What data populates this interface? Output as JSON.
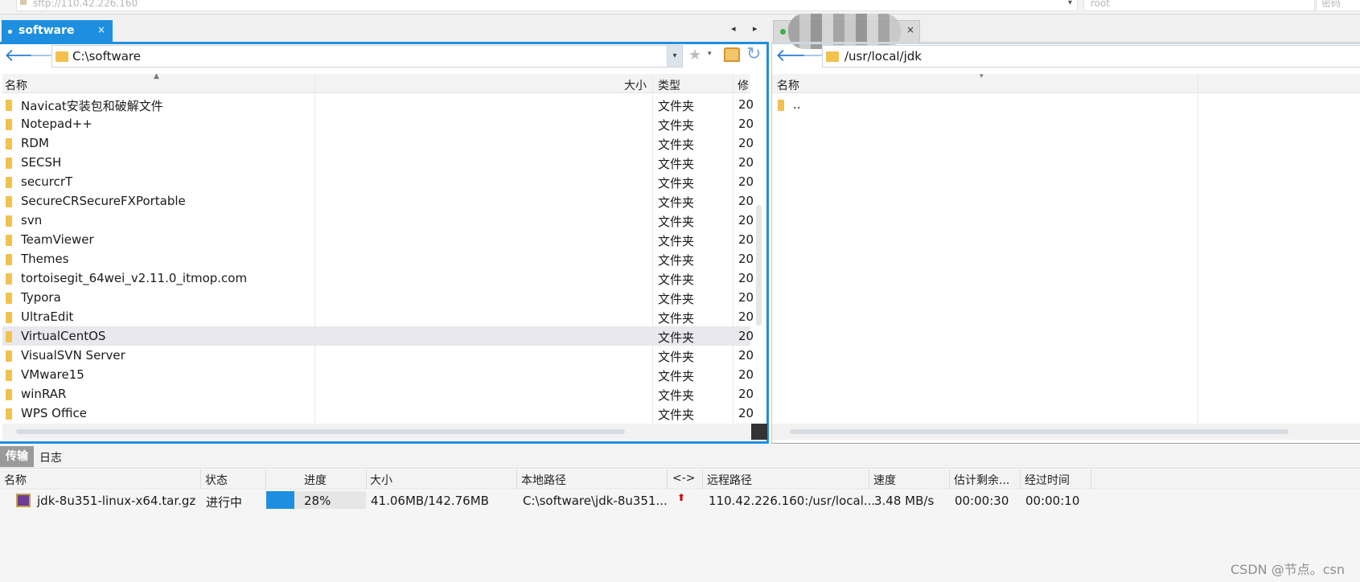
{
  "connection": {
    "url": "sftp://110.42.226.160",
    "username": "root",
    "password_placeholder": "密码"
  },
  "left_pane": {
    "tab_label": "software",
    "tab_close": "×",
    "path": "C:\\software",
    "columns": {
      "name": "名称",
      "size": "大小",
      "type": "类型",
      "modified": "修"
    },
    "files": [
      {
        "name": "Navicat安装包和破解文件",
        "type": "文件夹",
        "modified": "20"
      },
      {
        "name": "Notepad++",
        "type": "文件夹",
        "modified": "20"
      },
      {
        "name": "RDM",
        "type": "文件夹",
        "modified": "20"
      },
      {
        "name": "SECSH",
        "type": "文件夹",
        "modified": "20"
      },
      {
        "name": "securcrT",
        "type": "文件夹",
        "modified": "20"
      },
      {
        "name": "SecureCRSecureFXPortable",
        "type": "文件夹",
        "modified": "20"
      },
      {
        "name": "svn",
        "type": "文件夹",
        "modified": "20"
      },
      {
        "name": "TeamViewer",
        "type": "文件夹",
        "modified": "20"
      },
      {
        "name": "Themes",
        "type": "文件夹",
        "modified": "20"
      },
      {
        "name": "tortoisegit_64wei_v2.11.0_itmop.com",
        "type": "文件夹",
        "modified": "20"
      },
      {
        "name": "Typora",
        "type": "文件夹",
        "modified": "20"
      },
      {
        "name": "UltraEdit",
        "type": "文件夹",
        "modified": "20"
      },
      {
        "name": "VirtualCentOS",
        "type": "文件夹",
        "modified": "20",
        "selected": true
      },
      {
        "name": "VisualSVN Server",
        "type": "文件夹",
        "modified": "20"
      },
      {
        "name": "VMware15",
        "type": "文件夹",
        "modified": "20"
      },
      {
        "name": "winRAR",
        "type": "文件夹",
        "modified": "20"
      },
      {
        "name": "WPS Office",
        "type": "文件夹",
        "modified": "20"
      }
    ]
  },
  "right_pane": {
    "tab_close": "×",
    "path": "/usr/local/jdk",
    "columns": {
      "name": "名称"
    },
    "files": [
      {
        "name": ".."
      }
    ]
  },
  "transfer_panel": {
    "tabs": {
      "transfer": "传输",
      "log": "日志"
    },
    "columns": {
      "name": "名称",
      "status": "状态",
      "progress": "进度",
      "size": "大小",
      "local_path": "本地路径",
      "direction": "<->",
      "remote_path": "远程路径",
      "speed": "速度",
      "eta": "估计剩余...",
      "elapsed": "经过时间"
    },
    "items": [
      {
        "name": "jdk-8u351-linux-x64.tar.gz",
        "status": "进行中",
        "progress_percent": 28,
        "progress_label": "28%",
        "size": "41.06MB/142.76MB",
        "local_path": "C:\\software\\jdk-8u351...",
        "direction_icon": "upload-arrow-icon",
        "remote_path": "110.42.226.160:/usr/local...",
        "speed": "3.48 MB/s",
        "eta": "00:00:30",
        "elapsed": "00:00:10"
      }
    ]
  },
  "icons": {
    "nav_prev": "◂",
    "nav_next": "▸",
    "back": "🡐",
    "forward": "🡒",
    "star": "★",
    "dropdown": "▾",
    "sort": "▲",
    "refresh": "↻",
    "upload": "⬆"
  },
  "watermark": "CSDN @节点。csn",
  "colors": {
    "accent": "#1e8fe0",
    "progress": "#1e8fe0",
    "upload_arrow": "#d40000"
  }
}
